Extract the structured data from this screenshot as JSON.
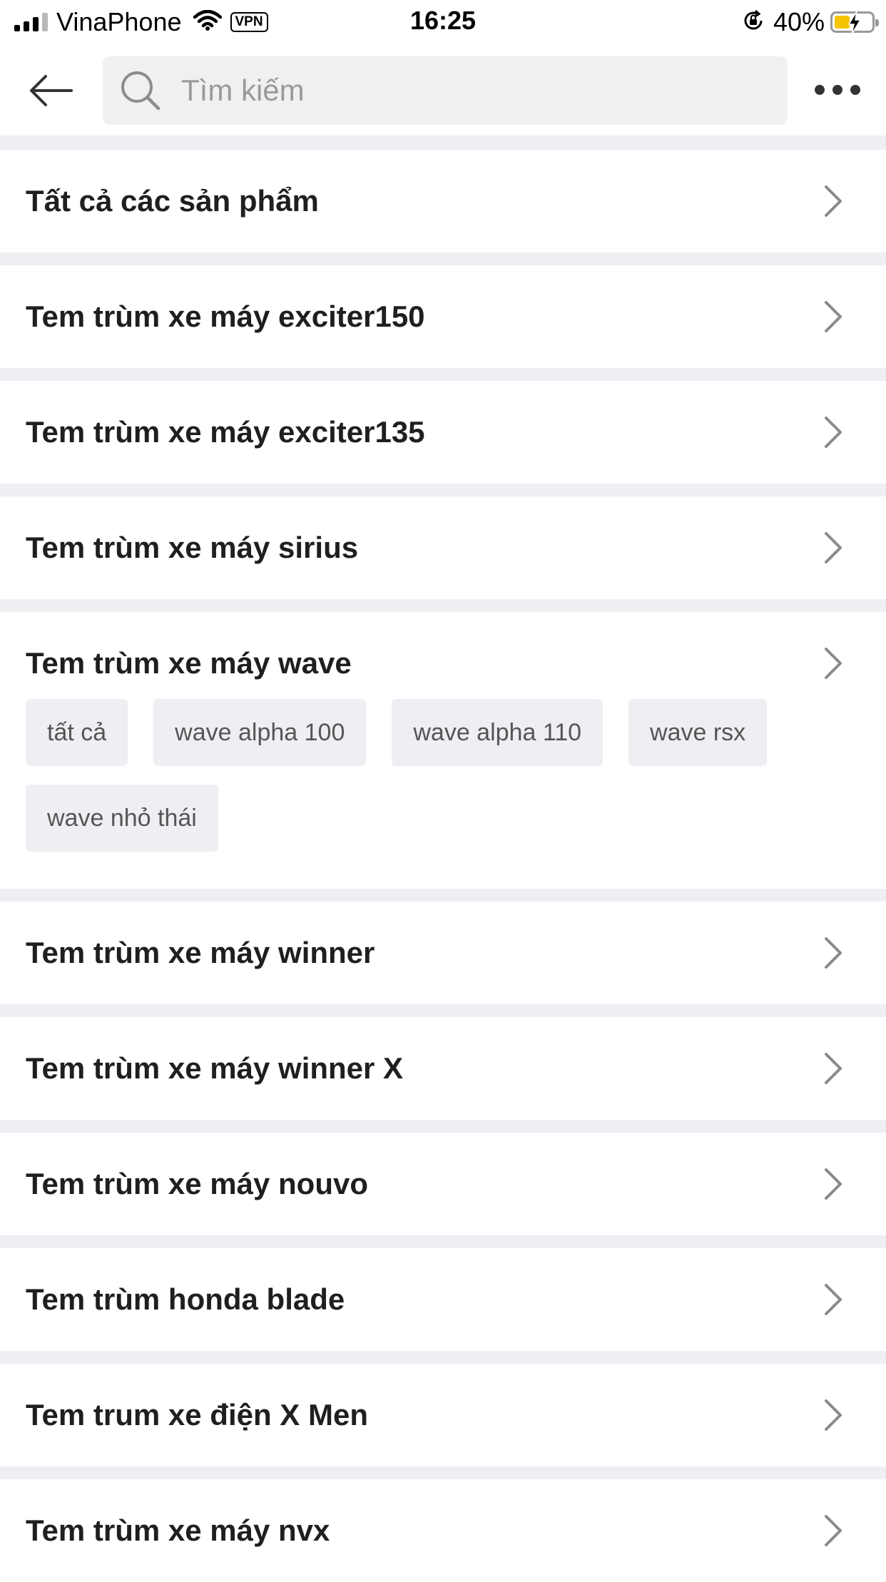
{
  "status_bar": {
    "carrier": "VinaPhone",
    "vpn": "VPN",
    "time": "16:25",
    "battery": "40%",
    "battery_level": 0.4
  },
  "header": {
    "search_placeholder": "Tìm kiếm",
    "icons": [
      "back-arrow-icon",
      "search-icon",
      "more-icon"
    ]
  },
  "categories": [
    {
      "title": "Tất cả các sản phẩm"
    },
    {
      "title": "Tem trùm xe máy exciter150"
    },
    {
      "title": "Tem trùm xe máy exciter135"
    },
    {
      "title": "Tem trùm xe máy sirius"
    },
    {
      "title": "Tem trùm xe máy wave",
      "subcategories": [
        "tất cả",
        "wave alpha 100",
        "wave alpha 110",
        "wave rsx",
        "wave nhỏ thái"
      ]
    },
    {
      "title": "Tem trùm xe máy winner"
    },
    {
      "title": "Tem trùm xe máy winner X"
    },
    {
      "title": "Tem trùm xe máy nouvo"
    },
    {
      "title": "Tem trùm honda blade"
    },
    {
      "title": "Tem trum xe điện X Men"
    },
    {
      "title": "Tem trùm xe máy nvx"
    }
  ]
}
